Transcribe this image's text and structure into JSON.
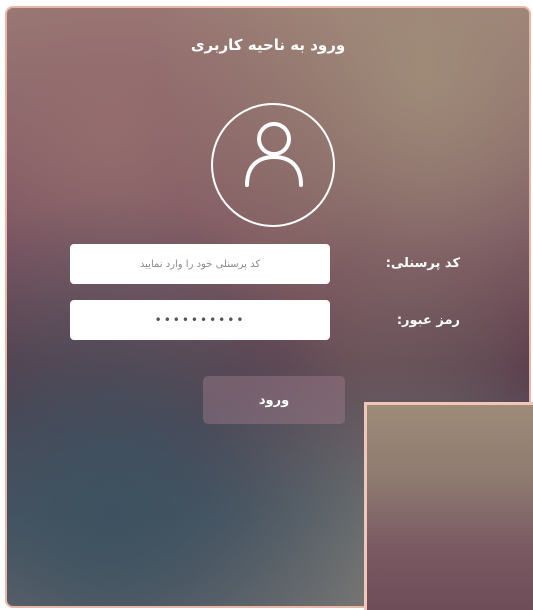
{
  "title": "ورود به ناحیه کاربری",
  "avatar": {
    "icon": "user-icon"
  },
  "personnel": {
    "label": "کد پرسنلی:",
    "placeholder": "کد پرسنلی خود را وارد نمایید"
  },
  "password": {
    "label": "رمز عبور:",
    "value": "••••••••••"
  },
  "login_button": {
    "label": "ورود"
  },
  "colors": {
    "frame_border": "#e8b7a6",
    "text": "#ffffff"
  }
}
